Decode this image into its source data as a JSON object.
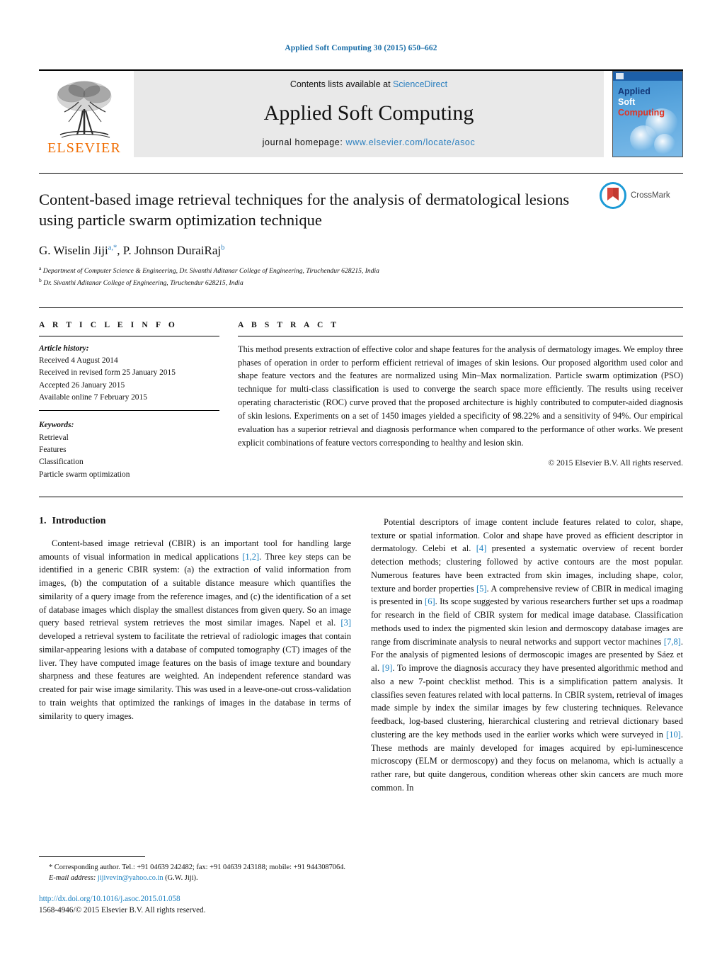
{
  "running_head": "Applied Soft Computing 30 (2015) 650–662",
  "masthead": {
    "contents_prefix": "Contents lists available at ",
    "sciencedirect": "ScienceDirect",
    "journal_title": "Applied Soft Computing",
    "homepage_label": "journal homepage:",
    "homepage_url": "www.elsevier.com/locate/asoc",
    "publisher": "ELSEVIER",
    "cover": {
      "line1": "Applied",
      "line2": "Soft",
      "line3": "Computing"
    }
  },
  "article": {
    "title": "Content-based image retrieval techniques for the analysis of dermatological lesions using particle swarm optimization technique",
    "authors_plain": "G. Wiselin Jiji",
    "author1": "G. Wiselin Jiji",
    "author1_sup": "a,*",
    "author2": "P. Johnson DuraiRaj",
    "author2_sup": "b",
    "affiliation_a_marker": "a",
    "affiliation_a": "Department of Computer Science & Engineering, Dr. Sivanthi Aditanar College of Engineering, Tiruchendur 628215, India",
    "affiliation_b_marker": "b",
    "affiliation_b": "Dr. Sivanthi Aditanar College of Engineering, Tiruchendur 628215, India",
    "crossmark_label": "CrossMark"
  },
  "article_info": {
    "heading": "A R T I C L E  I N F O",
    "history_label": "Article history:",
    "received": "Received 4 August 2014",
    "revised": "Received in revised form 25 January 2015",
    "accepted": "Accepted 26 January 2015",
    "available": "Available online 7 February 2015",
    "keywords_label": "Keywords:",
    "keywords": [
      "Retrieval",
      "Features",
      "Classification",
      "Particle swarm optimization"
    ]
  },
  "abstract": {
    "heading": "A B S T R A C T",
    "text": "This method presents extraction of effective color and shape features for the analysis of dermatology images. We employ three phases of operation in order to perform efficient retrieval of images of skin lesions. Our proposed algorithm used color and shape feature vectors and the features are normalized using Min–Max normalization. Particle swarm optimization (PSO) technique for multi-class classification is used to converge the search space more efficiently. The results using receiver operating characteristic (ROC) curve proved that the proposed architecture is highly contributed to computer-aided diagnosis of skin lesions. Experiments on a set of 1450 images yielded a specificity of 98.22% and a sensitivity of 94%. Our empirical evaluation has a superior retrieval and diagnosis performance when compared to the performance of other works. We present explicit combinations of feature vectors corresponding to healthy and lesion skin.",
    "copyright": "© 2015 Elsevier B.V. All rights reserved."
  },
  "body": {
    "section_number": "1.",
    "section_title": "Introduction",
    "left_para1_a": "Content-based image retrieval (CBIR) is an important tool for handling large amounts of visual information in medical applications ",
    "left_para1_ref1": "[1,2]",
    "left_para1_b": ". Three key steps can be identified in a generic CBIR system: (a) the extraction of valid information from images, (b) the computation of a suitable distance measure which quantifies the similarity of a query image from the reference images, and (c) the identification of a set of database images which display the smallest distances from given query. So an image query based retrieval system retrieves the most similar images. Napel et al. ",
    "left_para1_ref2": "[3]",
    "left_para1_c": " developed a retrieval system to facilitate the retrieval of radiologic images that contain similar-appearing lesions with a database of computed tomography (CT) images of the liver. They have computed image features on the basis of image texture and boundary sharpness and these features are weighted. An independent reference standard was created for pair wise image similarity. This was used in a leave-one-out cross-validation to train weights that optimized the rankings of images in the database in terms of similarity to query images.",
    "right_para1_a": "Potential descriptors of image content include features related to color, shape, texture or spatial information. Color and shape have proved as efficient descriptor in dermatology. Celebi et al. ",
    "right_para1_ref1": "[4]",
    "right_para1_b": " presented a systematic overview of recent border detection methods; clustering followed by active contours are the most popular. Numerous features have been extracted from skin images, including shape, color, texture and border properties ",
    "right_para1_ref2": "[5]",
    "right_para1_c": ". A comprehensive review of CBIR in medical imaging is presented in ",
    "right_para1_ref3": "[6]",
    "right_para1_d": ". Its scope suggested by various researchers further set ups a roadmap for research in the field of CBIR system for medical image database. Classification methods used to index the pigmented skin lesion and dermoscopy database images are range from discriminate analysis to neural networks and support vector machines ",
    "right_para1_ref4": "[7,8]",
    "right_para1_e": ". For the analysis of pigmented lesions of dermoscopic images are presented by Sáez et al. ",
    "right_para1_ref5": "[9]",
    "right_para1_f": ". To improve the diagnosis accuracy they have presented algorithmic method and also a new 7-point checklist method. This is a simplification pattern analysis. It classifies seven features related with local patterns. In CBIR system, retrieval of images made simple by index the similar images by few clustering techniques. Relevance feedback, log-based clustering, hierarchical clustering and retrieval dictionary based clustering are the key methods used in the earlier works which were surveyed in ",
    "right_para1_ref6": "[10]",
    "right_para1_g": ". These methods are mainly developed for images acquired by epi-luminescence microscopy (ELM or dermoscopy) and they focus on melanoma, which is actually a rather rare, but quite dangerous, condition whereas other skin cancers are much more common. In"
  },
  "footnotes": {
    "corresponding_marker": "*",
    "corresponding_text": " Corresponding author. Tel.: +91 04639 242482; fax: +91 04639 243188; mobile: +91 9443087064.",
    "email_label": "E-mail address:",
    "email": "jijivevin@yahoo.co.in",
    "email_owner": " (G.W. Jiji).",
    "doi": "http://dx.doi.org/10.1016/j.asoc.2015.01.058",
    "issn_copyright": "1568-4946/© 2015 Elsevier B.V. All rights reserved."
  }
}
